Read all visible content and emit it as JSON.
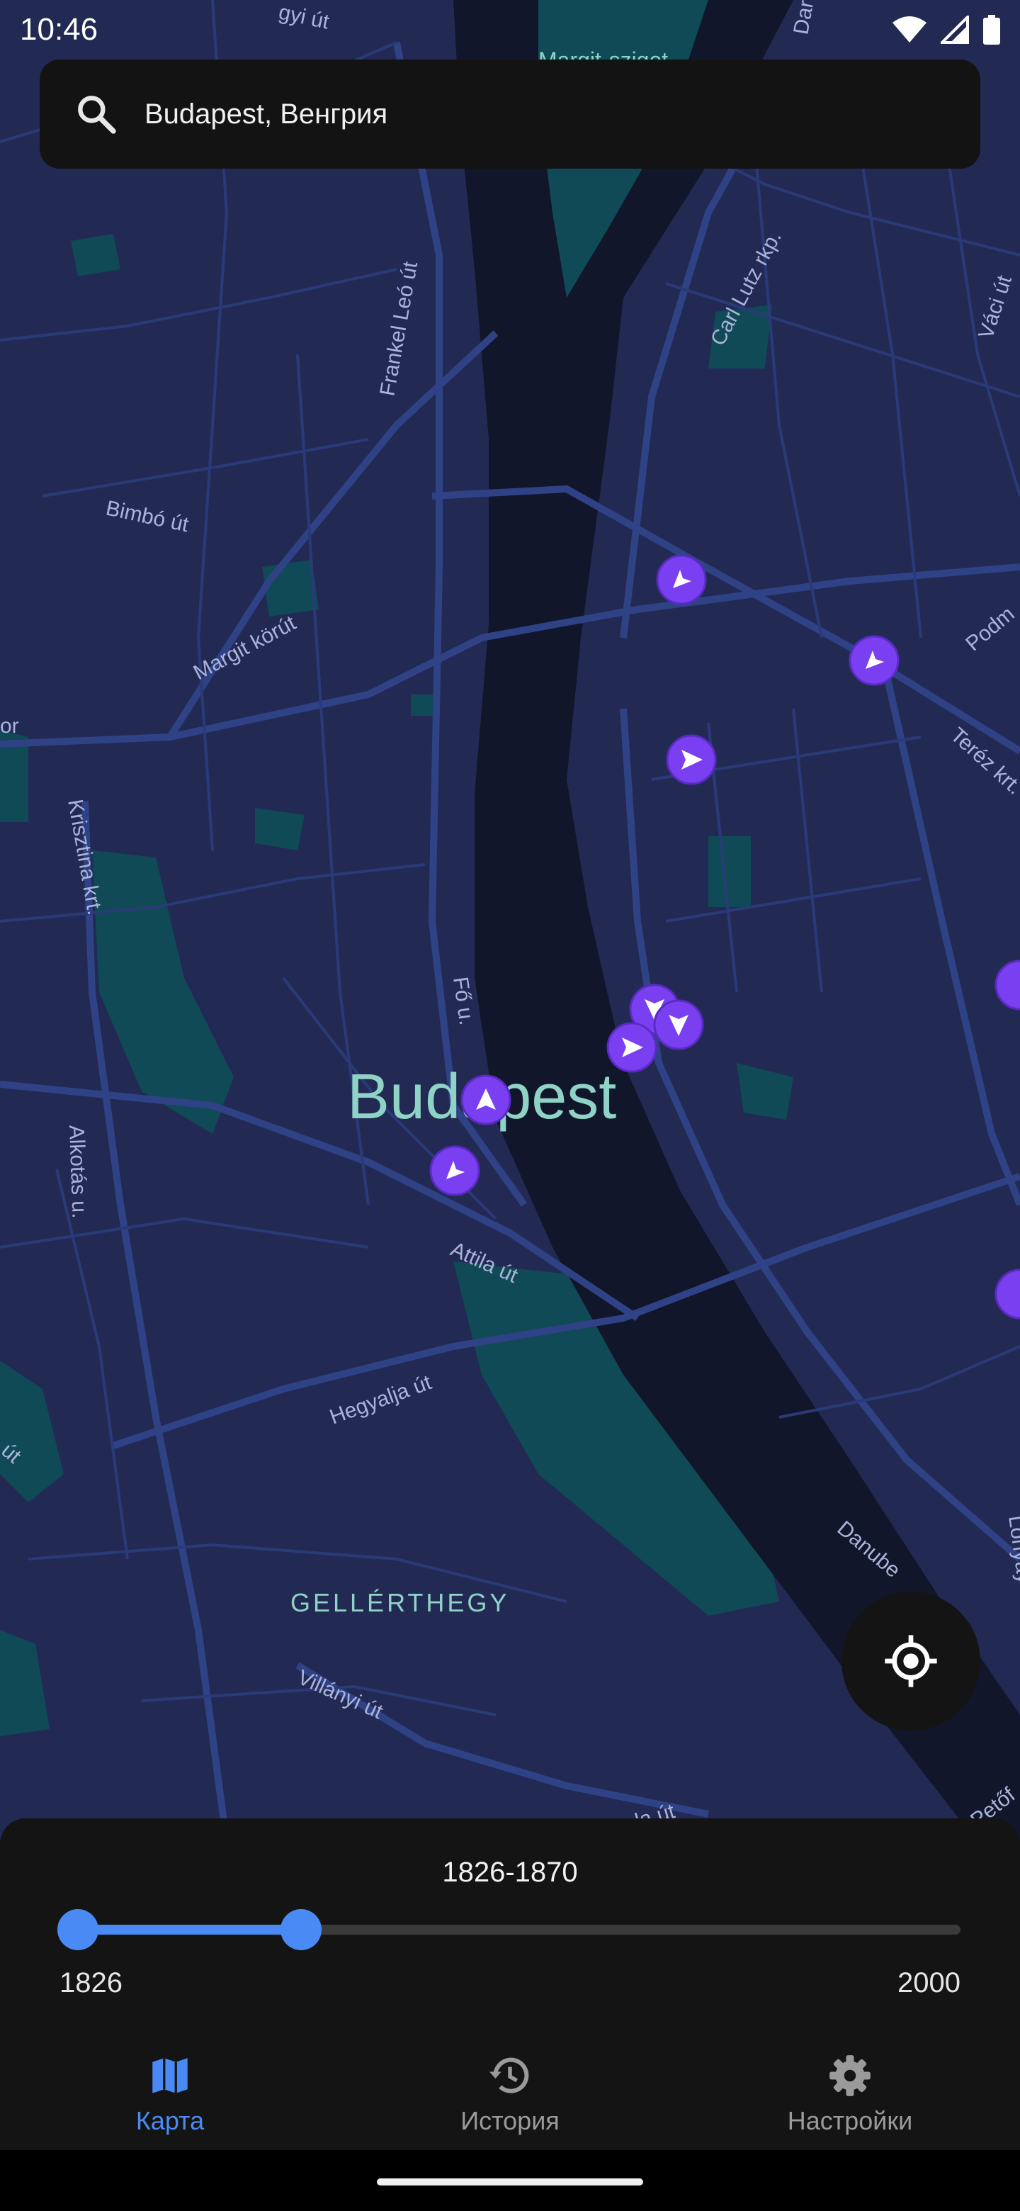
{
  "status_bar": {
    "time": "10:46",
    "icons": [
      "wifi-icon",
      "cellular-signal-icon",
      "battery-icon"
    ]
  },
  "search": {
    "icon": "search-icon",
    "value": "Budapest, Венгрия"
  },
  "map": {
    "city_label": "Budapest",
    "district_label": "GELLÉRTHEGY",
    "top_partial_label": "Margit-sziget",
    "street_labels": {
      "frankel": "Frankel Leó út",
      "carl_lutz": "Carl Lutz rkp.",
      "vaci": "Váci út",
      "bimbo": "Bimbó út",
      "margit_korut": "Margit körút",
      "podm": "Podm",
      "terez": "Teréz krt.",
      "krisztina": "Krisztina krt.",
      "fo": "Fő u.",
      "alkotas": "Alkotás u.",
      "attila": "Attila út",
      "hegyalja": "Hegyalja út",
      "villanyi": "Villányi út",
      "danube": "Danube",
      "lonyay": "Lónyay",
      "petofi": "Petőf",
      "gyi": "gyi út",
      "dar": "Dar",
      "or": "or",
      "ut_left": "út",
      "la_ut": "la út"
    },
    "marker_color": "#7b3ff2",
    "background_color": "#222a54",
    "river_color": "#11162b",
    "park_color": "#0f4a56"
  },
  "locate_button": {
    "icon": "gps-crosshair-icon"
  },
  "timeline": {
    "range_label": "1826-1870",
    "min_label": "1826",
    "max_label": "2000",
    "min": 1826,
    "max": 2000,
    "start": 1826,
    "end": 1870,
    "accent_color": "#4a8af4"
  },
  "nav": {
    "items": [
      {
        "label": "Карта",
        "icon": "map-icon",
        "active": true
      },
      {
        "label": "История",
        "icon": "history-icon",
        "active": false
      },
      {
        "label": "Настройки",
        "icon": "settings-gear-icon",
        "active": false
      }
    ]
  }
}
